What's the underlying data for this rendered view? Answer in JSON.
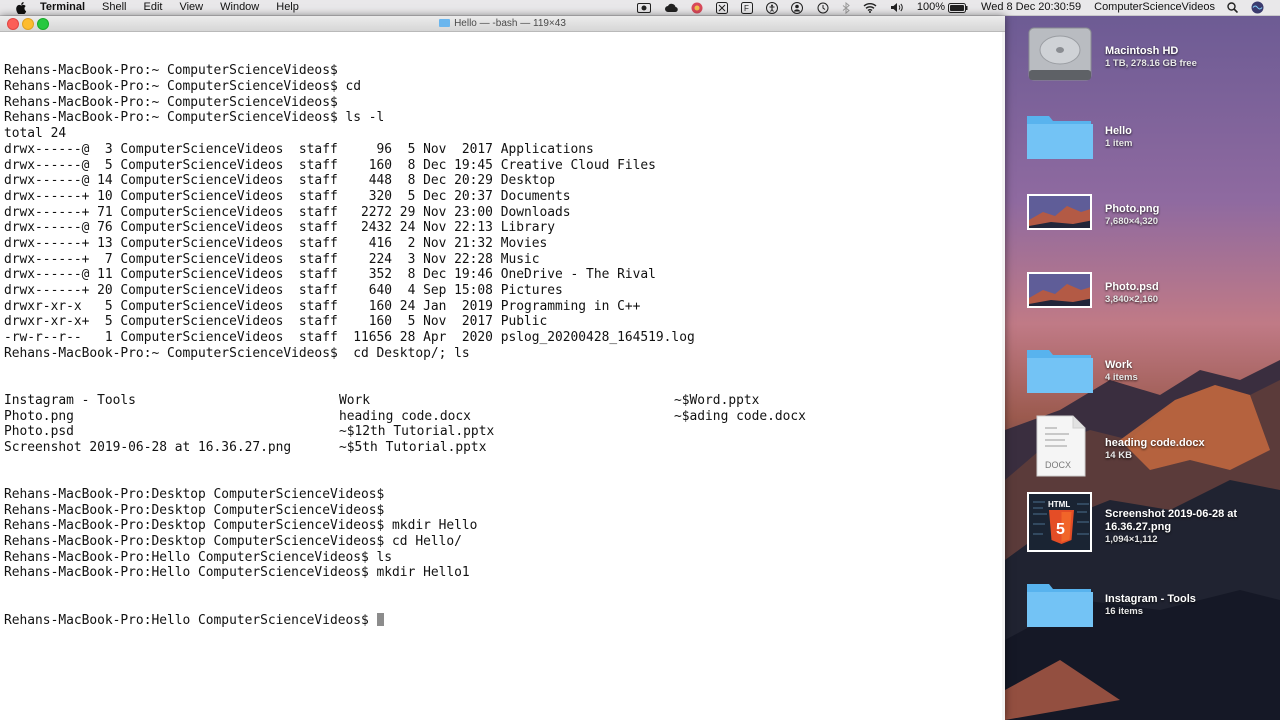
{
  "menubar": {
    "app": "Terminal",
    "items": [
      "Shell",
      "Edit",
      "View",
      "Window",
      "Help"
    ],
    "battery": "100%",
    "datetime": "Wed 8 Dec  20:30:59",
    "user": "ComputerScienceVideos"
  },
  "window": {
    "title": "Hello — -bash — 119×43"
  },
  "terminal": {
    "lines": [
      "Rehans-MacBook-Pro:~ ComputerScienceVideos$",
      "Rehans-MacBook-Pro:~ ComputerScienceVideos$ cd",
      "Rehans-MacBook-Pro:~ ComputerScienceVideos$",
      "Rehans-MacBook-Pro:~ ComputerScienceVideos$ ls -l",
      "total 24",
      "drwx------@  3 ComputerScienceVideos  staff     96  5 Nov  2017 Applications",
      "drwx------@  5 ComputerScienceVideos  staff    160  8 Dec 19:45 Creative Cloud Files",
      "drwx------@ 14 ComputerScienceVideos  staff    448  8 Dec 20:29 Desktop",
      "drwx------+ 10 ComputerScienceVideos  staff    320  5 Dec 20:37 Documents",
      "drwx------+ 71 ComputerScienceVideos  staff   2272 29 Nov 23:00 Downloads",
      "drwx------@ 76 ComputerScienceVideos  staff   2432 24 Nov 22:13 Library",
      "drwx------+ 13 ComputerScienceVideos  staff    416  2 Nov 21:32 Movies",
      "drwx------+  7 ComputerScienceVideos  staff    224  3 Nov 22:28 Music",
      "drwx------@ 11 ComputerScienceVideos  staff    352  8 Dec 19:46 OneDrive - The Rival",
      "drwx------+ 20 ComputerScienceVideos  staff    640  4 Sep 15:08 Pictures",
      "drwxr-xr-x   5 ComputerScienceVideos  staff    160 24 Jan  2019 Programming in C++",
      "drwxr-xr-x+  5 ComputerScienceVideos  staff    160  5 Nov  2017 Public",
      "-rw-r--r--   1 ComputerScienceVideos  staff  11656 28 Apr  2020 pslog_20200428_164519.log",
      "Rehans-MacBook-Pro:~ ComputerScienceVideos$  cd Desktop/; ls"
    ],
    "ls_grid": [
      [
        "Instagram - Tools",
        "Work",
        "~$Word.pptx"
      ],
      [
        "Photo.png",
        "heading code.docx",
        "~$ading code.docx"
      ],
      [
        "Photo.psd",
        "~$12th Tutorial.pptx",
        ""
      ],
      [
        "Screenshot 2019-06-28 at 16.36.27.png",
        "~$5th Tutorial.pptx",
        ""
      ]
    ],
    "lines_after": [
      "Rehans-MacBook-Pro:Desktop ComputerScienceVideos$",
      "Rehans-MacBook-Pro:Desktop ComputerScienceVideos$",
      "Rehans-MacBook-Pro:Desktop ComputerScienceVideos$ mkdir Hello",
      "Rehans-MacBook-Pro:Desktop ComputerScienceVideos$ cd Hello/",
      "Rehans-MacBook-Pro:Hello ComputerScienceVideos$ ls",
      "Rehans-MacBook-Pro:Hello ComputerScienceVideos$ mkdir Hello1"
    ],
    "prompt": "Rehans-MacBook-Pro:Hello ComputerScienceVideos$ "
  },
  "desktop": {
    "items": [
      {
        "name": "Macintosh HD",
        "sub": "1 TB, 278.16 GB free",
        "kind": "disk"
      },
      {
        "name": "Hello",
        "sub": "1 item",
        "kind": "folder"
      },
      {
        "name": "Photo.png",
        "sub": "7,680×4,320",
        "kind": "image"
      },
      {
        "name": "Photo.psd",
        "sub": "3,840×2,160",
        "kind": "image"
      },
      {
        "name": "Work",
        "sub": "4 items",
        "kind": "folder"
      },
      {
        "name": "heading code.docx",
        "sub": "14 KB",
        "kind": "docx"
      },
      {
        "name": "Screenshot 2019-06-28 at",
        "name2": "16.36.27.png",
        "sub": "1,094×1,112",
        "kind": "html"
      },
      {
        "name": "Instagram - Tools",
        "sub": "16 items",
        "kind": "folder"
      }
    ],
    "docx_badge": "DOCX",
    "html_badge": "HTML",
    "html_num": "5"
  }
}
